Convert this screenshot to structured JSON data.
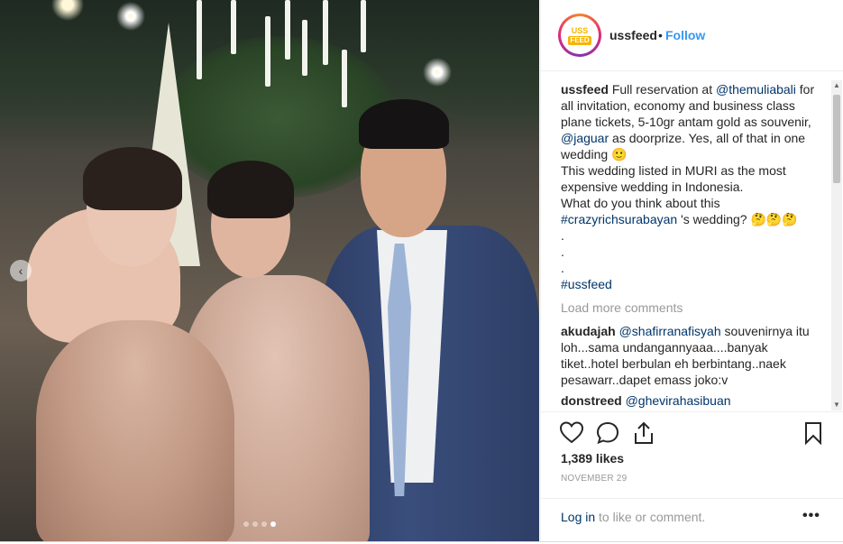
{
  "header": {
    "username": "ussfeed",
    "separator": "•",
    "follow": "Follow",
    "avatar_top": "USS",
    "avatar_bottom": "FEED"
  },
  "caption": {
    "username": "ussfeed",
    "text_1": "Full reservation at",
    "mention_1": "@themuliabali",
    "text_2": "for all invitation, economy and business class plane tickets, 5-10gr antam gold as souvenir,",
    "mention_2": "@jaguar",
    "text_3": "as doorprize. Yes, all of that in one wedding 🙂",
    "line_2": "This wedding listed in MURI as the most expensive wedding in Indonesia.",
    "line_3": "What do you think about this",
    "hashtag_1": "#crazyrichsurabayan",
    "line_3_end": "'s wedding? 🤔🤔🤔",
    "dot_1": ".",
    "dot_2": ".",
    "dot_3": ".",
    "hashtag_2": "#ussfeed"
  },
  "load_more": "Load more comments",
  "comments": [
    {
      "user": "akudajah",
      "mention": "@shafirranafisyah",
      "text": "souvenirnya itu loh...sama undangannyaaa....banyak tiket..hotel berbulan eh berbintang..naek pesawarr..dapet emass joko:v"
    },
    {
      "user": "donstreed",
      "mention": "@ghevirahasibuan",
      "text": ""
    }
  ],
  "icons": {
    "like": "heart-icon",
    "comment": "comment-icon",
    "share": "share-icon",
    "save": "bookmark-icon",
    "prev": "chevron-left-icon"
  },
  "likes": "1,389 likes",
  "date": "NOVEMBER 29",
  "footer": {
    "login": "Log in",
    "rest": "to like or comment.",
    "more": "•••"
  },
  "carousel": {
    "prev_glyph": "‹",
    "total_slides": 4,
    "active_slide": 4
  },
  "colors": {
    "link": "#003569",
    "follow": "#3897f0",
    "muted": "#999999"
  }
}
